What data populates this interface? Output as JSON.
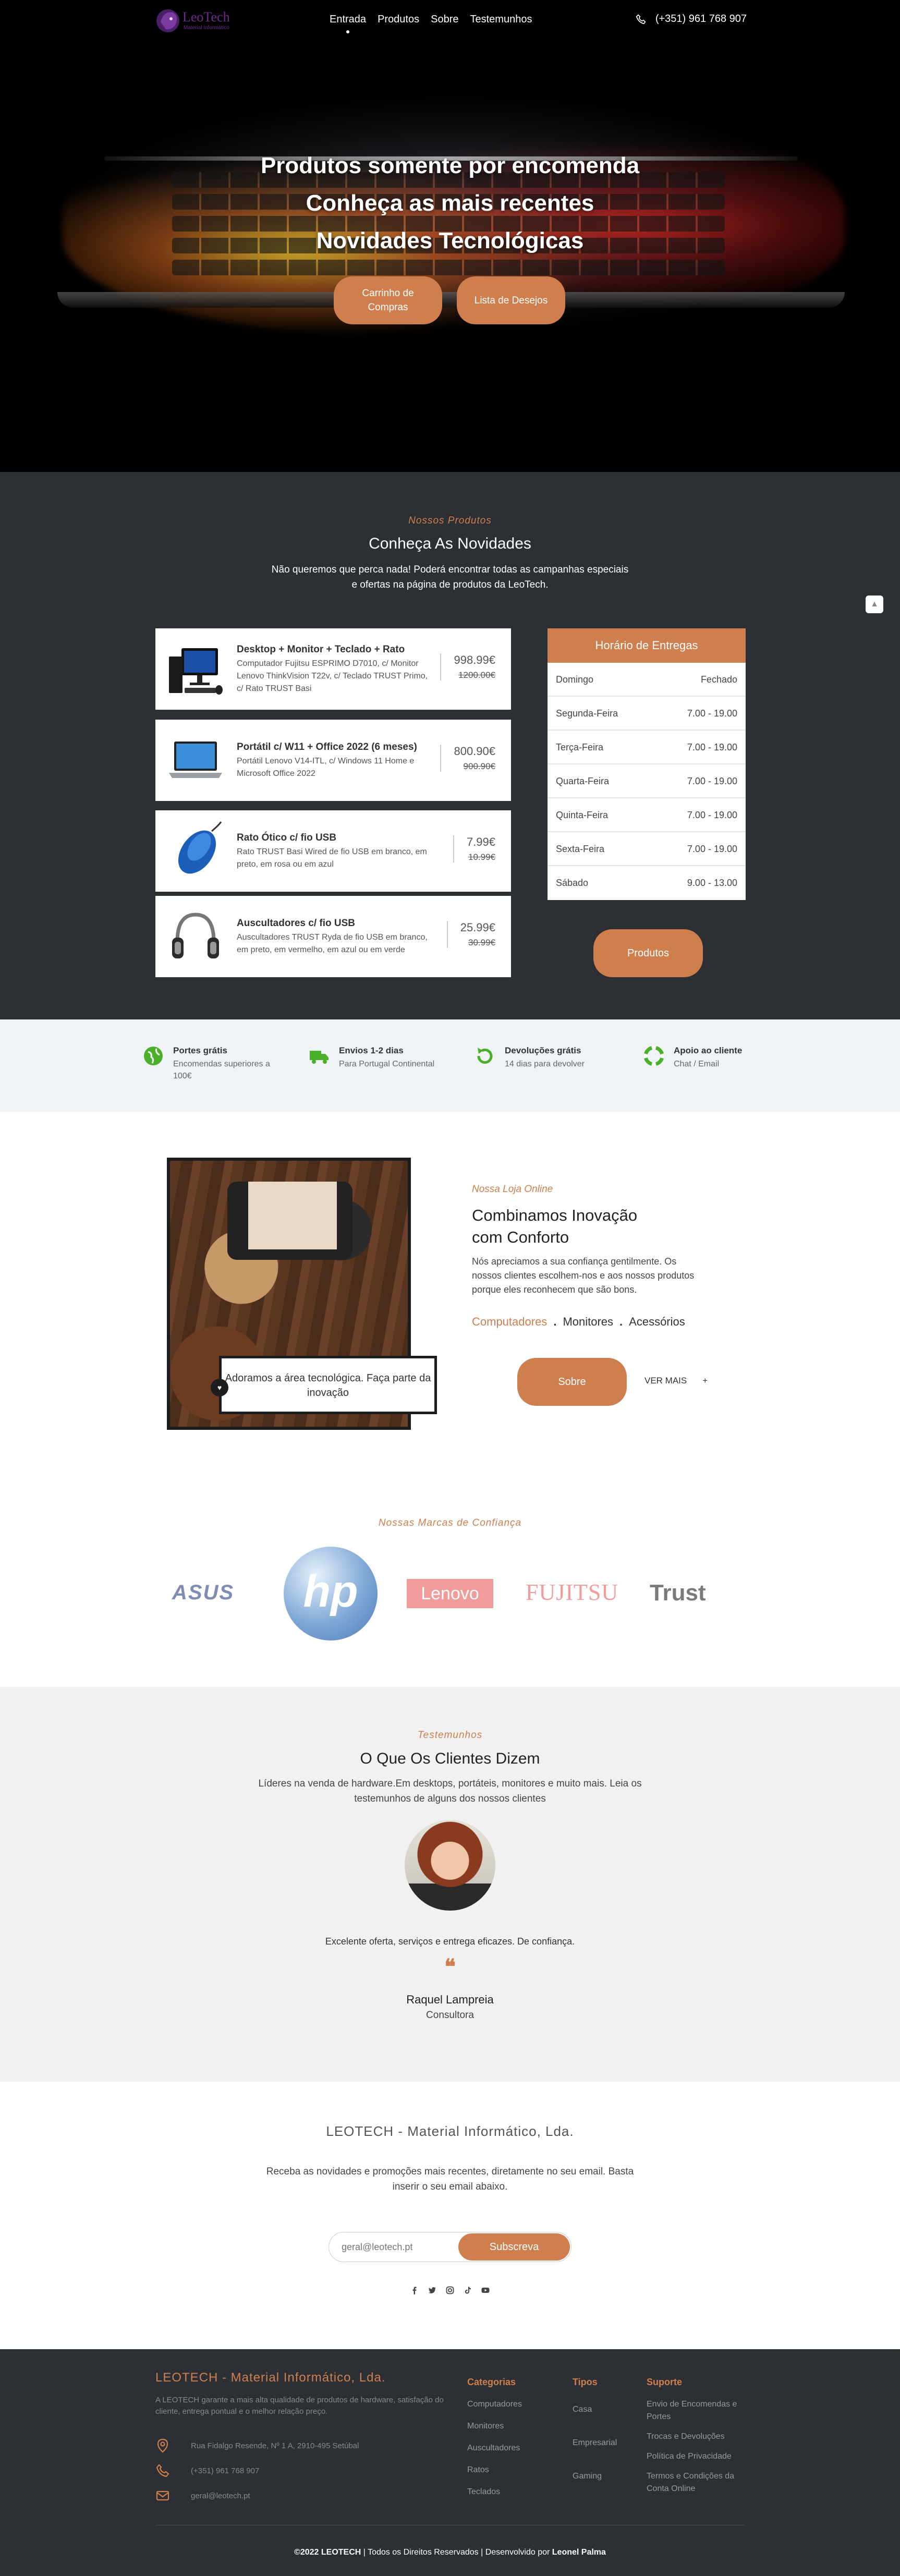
{
  "nav": {
    "logo_text": "LeoTech",
    "logo_sub": "Material Informático",
    "links": [
      "Entrada",
      "Produtos",
      "Sobre",
      "Testemunhos"
    ],
    "phone": "(+351) 961 768 907"
  },
  "hero": {
    "title_lines": [
      "Produtos somente por encomenda",
      "Conheça as mais recentes",
      "Novidades Tecnológicas"
    ],
    "btn_cart": "Carrinho de Compras",
    "btn_wishlist": "Lista de Desejos"
  },
  "products": {
    "kicker": "Nossos Produtos",
    "title": "Conheça As Novidades",
    "desc": "Não queremos que perca nada! Poderá encontrar todas as campanhas especiais e ofertas na página de produtos da LeoTech.",
    "items": [
      {
        "name": "Desktop + Monitor + Teclado + Rato",
        "desc": "Computador Fujitsu ESPRIMO D7010, c/ Monitor Lenovo ThinkVision T22v, c/ Teclado TRUST Primo, c/ Rato TRUST Basi",
        "price": "998.99€",
        "old": "1200.00€",
        "icon": "desktop-icon"
      },
      {
        "name": "Portátil c/ W11 + Office 2022 (6 meses)",
        "desc": "Portátil Lenovo V14-ITL, c/ Windows 11 Home e Microsoft Office 2022",
        "price": "800.90€",
        "old": "900.90€",
        "icon": "laptop-icon"
      },
      {
        "name": "Rato Ótico c/ fio USB",
        "desc": "Rato TRUST Basi Wired de fio USB em branco, em preto, em rosa ou em azul",
        "price": "7.99€",
        "old": "10.99€",
        "icon": "mouse-icon"
      },
      {
        "name": "Auscultadores c/ fio USB",
        "desc": "Auscultadores TRUST Ryda de fio USB em branco, em preto, em vermelho, em azul ou em verde",
        "price": "25.99€",
        "old": "30.99€",
        "icon": "headphones-icon"
      }
    ],
    "hours_title": "Horário de Entregas",
    "hours": [
      {
        "day": "Domingo",
        "time": "Fechado"
      },
      {
        "day": "Segunda-Feira",
        "time": "7.00 - 19.00"
      },
      {
        "day": "Terça-Feira",
        "time": "7.00 - 19.00"
      },
      {
        "day": "Quarta-Feira",
        "time": "7.00 - 19.00"
      },
      {
        "day": "Quinta-Feira",
        "time": "7.00 - 19.00"
      },
      {
        "day": "Sexta-Feira",
        "time": "7.00 - 19.00"
      },
      {
        "day": "Sábado",
        "time": "9.00 - 13.00"
      }
    ],
    "btn": "Produtos"
  },
  "features": [
    {
      "title": "Portes grátis",
      "sub": "Encomendas superiores a 100€",
      "icon": "globe-icon"
    },
    {
      "title": "Envios 1-2 dias",
      "sub": "Para Portugal Continental",
      "icon": "truck-icon"
    },
    {
      "title": "Devoluções grátis",
      "sub": "14 dias para devolver",
      "icon": "return-icon"
    },
    {
      "title": "Apoio ao cliente",
      "sub": "Chat / Email",
      "icon": "lifebuoy-icon"
    }
  ],
  "about": {
    "note": "Adoramos a área tecnológica. Faça parte da inovação",
    "kicker": "Nossa Loja Online",
    "title": "Combinamos Inovação com Conforto",
    "text": "Nós apreciamos a sua confiança gentilmente. Os nossos clientes escolhem-nos e aos nossos produtos porque eles reconhecem que são bons.",
    "cats": [
      "Computadores",
      "Monitores",
      "Acessórios"
    ],
    "btn": "Sobre",
    "more": "VER MAIS",
    "more_arrow": "+"
  },
  "brands": {
    "kicker": "Nossas Marcas de Confiança",
    "items": [
      "ASUS",
      "hp",
      "Lenovo",
      "FUJITSU",
      "Trust"
    ]
  },
  "testimonials": {
    "kicker": "Testemunhos",
    "title": "O Que Os Clientes Dizem",
    "desc": "Líderes na venda de hardware.Em desktops, portáteis, monitores e muito mais. Leia os testemunhos de alguns dos nossos clientes",
    "quote": "Excelente oferta, serviços e entrega eficazes. De confiança.",
    "mark": "❝",
    "name": "Raquel Lampreia",
    "role": "Consultora"
  },
  "newsletter": {
    "title": "LEOTECH - Material Informático, Lda.",
    "text": "Receba as novidades e promoções mais recentes, diretamente no seu email. Basta inserir o seu email abaixo.",
    "placeholder": "geral@leotech.pt",
    "btn": "Subscreva",
    "socials": [
      "facebook-icon",
      "twitter-icon",
      "instagram-icon",
      "tiktok-icon",
      "youtube-icon"
    ]
  },
  "footer": {
    "title": "LEOTECH - Material Informático, Lda.",
    "desc": "A LEOTECH garante a mais alta qualidade de produtos de hardware, satisfação do cliente, entrega pontual e o melhor relação preço.",
    "address": "Rua Fidalgo Resende, Nº 1 A, 2910-495 Setúbal",
    "phone": "(+351) 961 768 907",
    "email": "geral@leotech.pt",
    "cols": [
      {
        "title": "Categorias",
        "items": [
          "Computadores",
          "Monitores",
          "Auscultadores",
          "Ratos",
          "Teclados"
        ]
      },
      {
        "title": "Tipos",
        "items": [
          "Casa",
          "Empresarial",
          "Gaming"
        ]
      },
      {
        "title": "Suporte",
        "items": [
          "Envio de Encomendas e Portes",
          "Trocas e Devoluções",
          "Política de Privacidade",
          "Termos e Condições da Conta Online"
        ]
      }
    ],
    "copy_a": "©2022 LEOTECH",
    "copy_b": " | Todos os Direitos Reservados | Desenvolvido por ",
    "copy_c": "Leonel Palma"
  },
  "colors": {
    "accent": "#cf7f4e",
    "dark": "#2c2f33",
    "light": "#eff3f6"
  }
}
